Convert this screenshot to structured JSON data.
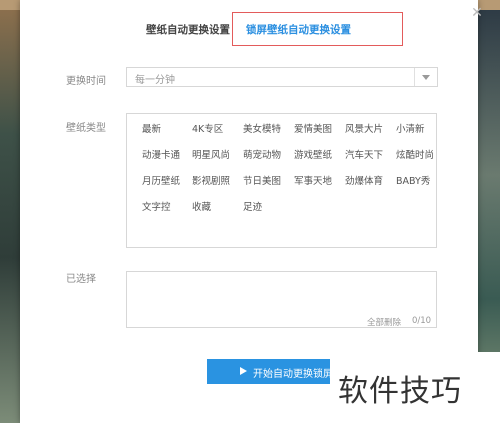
{
  "tabs": [
    "壁纸自动更换设置",
    "锁屏壁纸自动更换设置"
  ],
  "interval": {
    "label": "更换时间",
    "value": "每一分钟"
  },
  "types": {
    "label": "壁纸类型",
    "items": [
      "最新",
      "4K专区",
      "美女模特",
      "爱情美图",
      "风景大片",
      "小清新",
      "动漫卡通",
      "明星风尚",
      "萌宠动物",
      "游戏壁纸",
      "汽车天下",
      "炫酷时尚",
      "月历壁纸",
      "影视剧照",
      "节日美图",
      "军事天地",
      "劲爆体育",
      "BABY秀",
      "文字控",
      "收藏",
      "足迹"
    ]
  },
  "selected": {
    "label": "已选择",
    "clear": "全部删除",
    "count": "0/10"
  },
  "start_button": "开始自动更换锁屏",
  "watermark": "软件技巧",
  "colors": {
    "accent": "#2a93e1",
    "highlight": "#e35b5b"
  },
  "icons": {
    "close": "close-icon",
    "dropdown": "chevron-down-icon",
    "play": "play-icon"
  }
}
